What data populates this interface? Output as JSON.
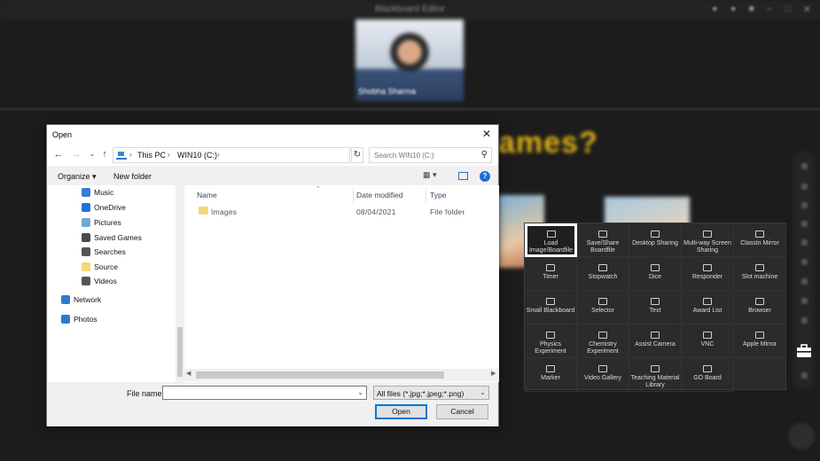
{
  "background": {
    "window_title": "Blackboard Editor",
    "video_name": "Shobha Sharma",
    "heading_fragment": "ames?"
  },
  "toolbox": {
    "items": [
      {
        "label": "Load Image/Boardfile",
        "icon": "folder-icon",
        "selected": true
      },
      {
        "label": "Save/Share Boardfile",
        "icon": "save-icon"
      },
      {
        "label": "Desktop Sharing",
        "icon": "monitor-share-icon"
      },
      {
        "label": "Multi-way Screen Sharing",
        "icon": "multi-screen-icon"
      },
      {
        "label": "ClassIn Mirror",
        "icon": "mirror-icon"
      },
      {
        "label": "Timer",
        "icon": "timer-icon"
      },
      {
        "label": "Stopwatch",
        "icon": "stopwatch-icon"
      },
      {
        "label": "Dice",
        "icon": "dice-icon"
      },
      {
        "label": "Responder",
        "icon": "responder-icon"
      },
      {
        "label": "Slot machine",
        "icon": "slot-machine-icon"
      },
      {
        "label": "Small Blackboard",
        "icon": "small-blackboard-icon"
      },
      {
        "label": "Selector",
        "icon": "selector-icon"
      },
      {
        "label": "Text",
        "icon": "text-icon"
      },
      {
        "label": "Award List",
        "icon": "award-list-icon"
      },
      {
        "label": "Browser",
        "icon": "browser-icon"
      },
      {
        "label": "Physics Experiment",
        "icon": "physics-icon"
      },
      {
        "label": "Chemistry Experiment",
        "icon": "chemistry-icon"
      },
      {
        "label": "Assist Camera",
        "icon": "camera-icon"
      },
      {
        "label": "VNC",
        "icon": "vnc-icon"
      },
      {
        "label": "Apple Mirror",
        "icon": "apple-mirror-icon"
      },
      {
        "label": "Marker",
        "icon": "marker-icon"
      },
      {
        "label": "Video Gallery",
        "icon": "video-gallery-icon"
      },
      {
        "label": "Teaching Material Library",
        "icon": "library-icon"
      },
      {
        "label": "GO Board",
        "icon": "go-board-icon"
      }
    ]
  },
  "dialog": {
    "title": "Open",
    "close_glyph": "✕",
    "nav": {
      "back": "←",
      "forward": "→",
      "recent": "⌄",
      "up": "↑"
    },
    "breadcrumbs": [
      "This PC",
      "WIN10 (C:)"
    ],
    "crumb_sep": "›",
    "refresh_glyph": "↻",
    "search_placeholder": "Search WIN10 (C:)",
    "organize_label": "Organize ▾",
    "new_folder_label": "New folder",
    "help_glyph": "?",
    "nav_items": [
      {
        "label": "Music",
        "icon": "music-icon",
        "color": "#3a7bd5"
      },
      {
        "label": "OneDrive",
        "icon": "onedrive-icon",
        "color": "#1e73d8"
      },
      {
        "label": "Pictures",
        "icon": "pictures-icon",
        "color": "#6fa7d8"
      },
      {
        "label": "Saved Games",
        "icon": "saved-games-icon",
        "color": "#4a4a4a"
      },
      {
        "label": "Searches",
        "icon": "search-icon",
        "color": "#555555"
      },
      {
        "label": "Source",
        "icon": "folder-icon",
        "color": "#f4d778"
      },
      {
        "label": "Videos",
        "icon": "videos-icon",
        "color": "#555555"
      },
      {
        "label": "Network",
        "icon": "network-icon",
        "color": "#2f7ad1"
      },
      {
        "label": "Photos",
        "icon": "photos-icon",
        "color": "#2f7ad1"
      }
    ],
    "columns": [
      "Name",
      "Date modified",
      "Type"
    ],
    "files": [
      {
        "name": "Images",
        "date": "08/04/2021",
        "type": "File folder"
      }
    ],
    "file_name_label": "File name:",
    "file_name_value": "",
    "filter_value": "All files (*.jpg;*.jpeg;*.png)",
    "open_label": "Open",
    "cancel_label": "Cancel"
  },
  "colors": {
    "accent": "#0078d7",
    "heading_yellow": "#e0b317",
    "toolbox_bg": "#2b2b2b"
  }
}
